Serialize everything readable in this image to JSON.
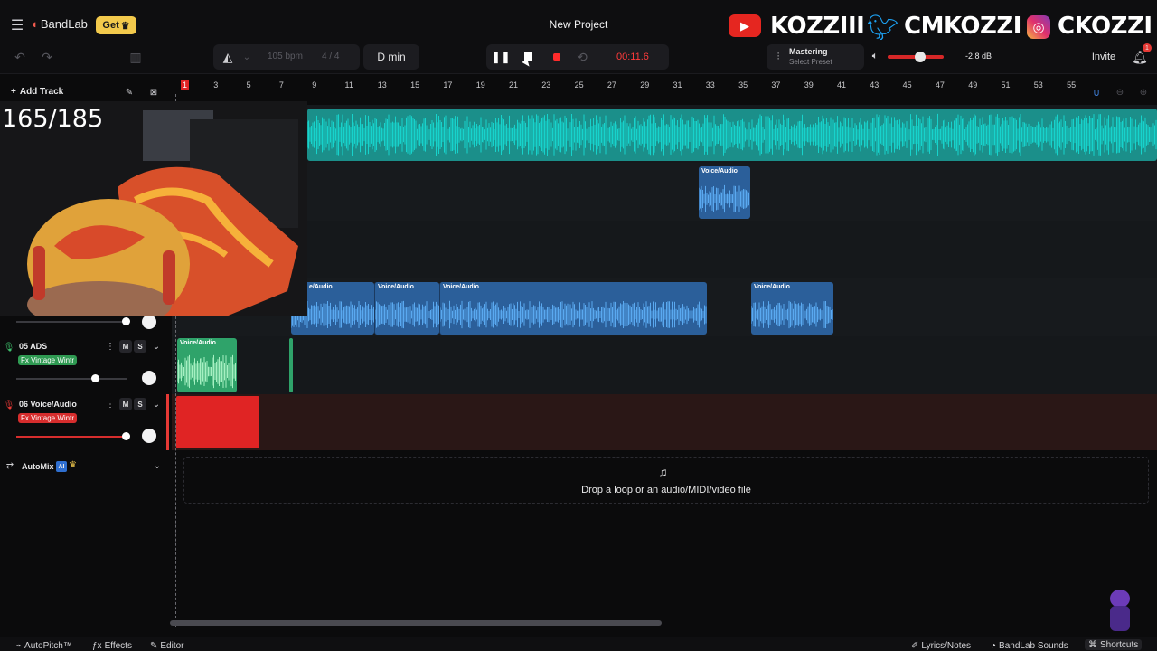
{
  "header": {
    "logo_text": "BandLab",
    "get_label": "Get",
    "project_title": "New Project",
    "socials": [
      "KOZZIII",
      "CMKOZZI",
      "CKOZZI"
    ],
    "notification_count": "1"
  },
  "toolbar": {
    "bpm": "105",
    "bpm_unit": "bpm",
    "time_signature": "4 / 4",
    "key": "D min",
    "time": "00:11.6",
    "mastering_label": "Mastering",
    "mastering_preset": "Select Preset",
    "volume_db": "-2.8 dB",
    "invite_label": "Invite"
  },
  "left": {
    "add_track_label": "Add Track",
    "counter": "165/185",
    "tracks": [
      {
        "number": "05",
        "name": "ADS",
        "fx": "Fx Vintage Wintr",
        "color": "#3dbd6a",
        "mute": "M",
        "solo": "S"
      },
      {
        "number": "06",
        "name": "Voice/Audio",
        "fx": "Fx Vintage Wintr",
        "color": "#e53935",
        "mute": "M",
        "solo": "S"
      }
    ],
    "automix_label": "AutoMix",
    "ai_badge": "AI"
  },
  "ruler": [
    "1",
    "3",
    "5",
    "7",
    "9",
    "11",
    "13",
    "15",
    "17",
    "19",
    "21",
    "23",
    "25",
    "27",
    "29",
    "31",
    "33",
    "35",
    "37",
    "39",
    "41",
    "43",
    "45",
    "47",
    "49",
    "51",
    "53",
    "55"
  ],
  "clips": {
    "voice_label": "Voice/Audio",
    "partial_label": "e/Audio"
  },
  "dropzone": {
    "text": "Drop a loop or an audio/MIDI/video file"
  },
  "bottom": {
    "autopitch": "AutoPitch™",
    "effects": "Effects",
    "editor": "Editor",
    "lyrics": "Lyrics/Notes",
    "sounds": "BandLab Sounds",
    "shortcuts": "Shortcuts"
  },
  "colors": {
    "teal": "#17d3cc",
    "blue": "#3d8fe0",
    "green": "#2fb56a",
    "red": "#e53935",
    "accent": "#ff2b2b"
  }
}
